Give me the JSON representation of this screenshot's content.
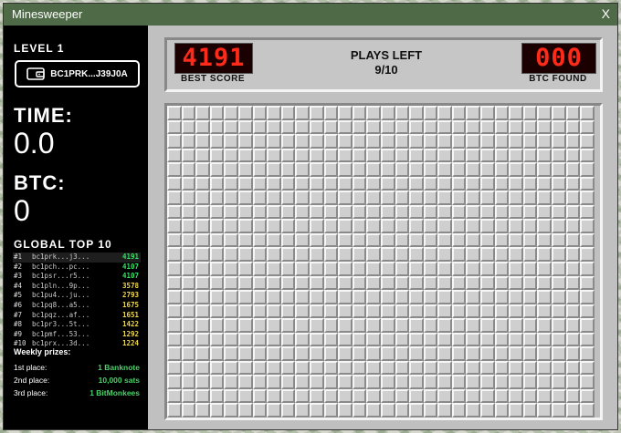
{
  "window": {
    "title": "Minesweeper",
    "close_label": "X"
  },
  "sidebar": {
    "level_label": "LEVEL 1",
    "wallet": {
      "icon": "wallet-icon",
      "address": "BC1PRK...J39J0A"
    },
    "time_label": "TIME:",
    "time_value": "0.0",
    "btc_label": "BTC:",
    "btc_value": "0",
    "leaderboard_title": "GLOBAL TOP 10",
    "leaderboard": [
      {
        "rank": "#1",
        "address": "bc1prk...j3...",
        "score": "4191",
        "color": "#34e065"
      },
      {
        "rank": "#2",
        "address": "bc1pch...pc...",
        "score": "4107",
        "color": "#34e065"
      },
      {
        "rank": "#3",
        "address": "bc1psr...r5...",
        "score": "4107",
        "color": "#34e065"
      },
      {
        "rank": "#4",
        "address": "bc1pln...9p...",
        "score": "3578",
        "color": "#f0d84a"
      },
      {
        "rank": "#5",
        "address": "bc1pu4...ju...",
        "score": "2793",
        "color": "#f0d84a"
      },
      {
        "rank": "#6",
        "address": "bc1pq8...a5...",
        "score": "1675",
        "color": "#f0d84a"
      },
      {
        "rank": "#7",
        "address": "bc1pqz...af...",
        "score": "1651",
        "color": "#f0d84a"
      },
      {
        "rank": "#8",
        "address": "bc1pr3...5t...",
        "score": "1422",
        "color": "#f0d84a"
      },
      {
        "rank": "#9",
        "address": "bc1pmf...53...",
        "score": "1292",
        "color": "#f0d84a"
      },
      {
        "rank": "#10",
        "address": "bc1prx...3d...",
        "score": "1224",
        "color": "#f0d84a"
      }
    ],
    "prizes_title": "Weekly prizes:",
    "prizes": [
      {
        "place": "1st place:",
        "prize": "1 Banknote"
      },
      {
        "place": "2nd place:",
        "prize": "10,000 sats"
      },
      {
        "place": "3rd place:",
        "prize": "1 BitMonkees"
      }
    ]
  },
  "scoreboard": {
    "best_score": "4191",
    "best_score_label": "BEST SCORE",
    "plays_left_label": "PLAYS LEFT",
    "plays_left_value": "9/10",
    "btc_found": "000",
    "btc_found_label": "BTC FOUND"
  },
  "board": {
    "cols": 30,
    "rows": 22
  },
  "colors": {
    "title_bar": "#4e6a46",
    "led_red": "#ff2a1a",
    "prize_green": "#4bd168"
  }
}
